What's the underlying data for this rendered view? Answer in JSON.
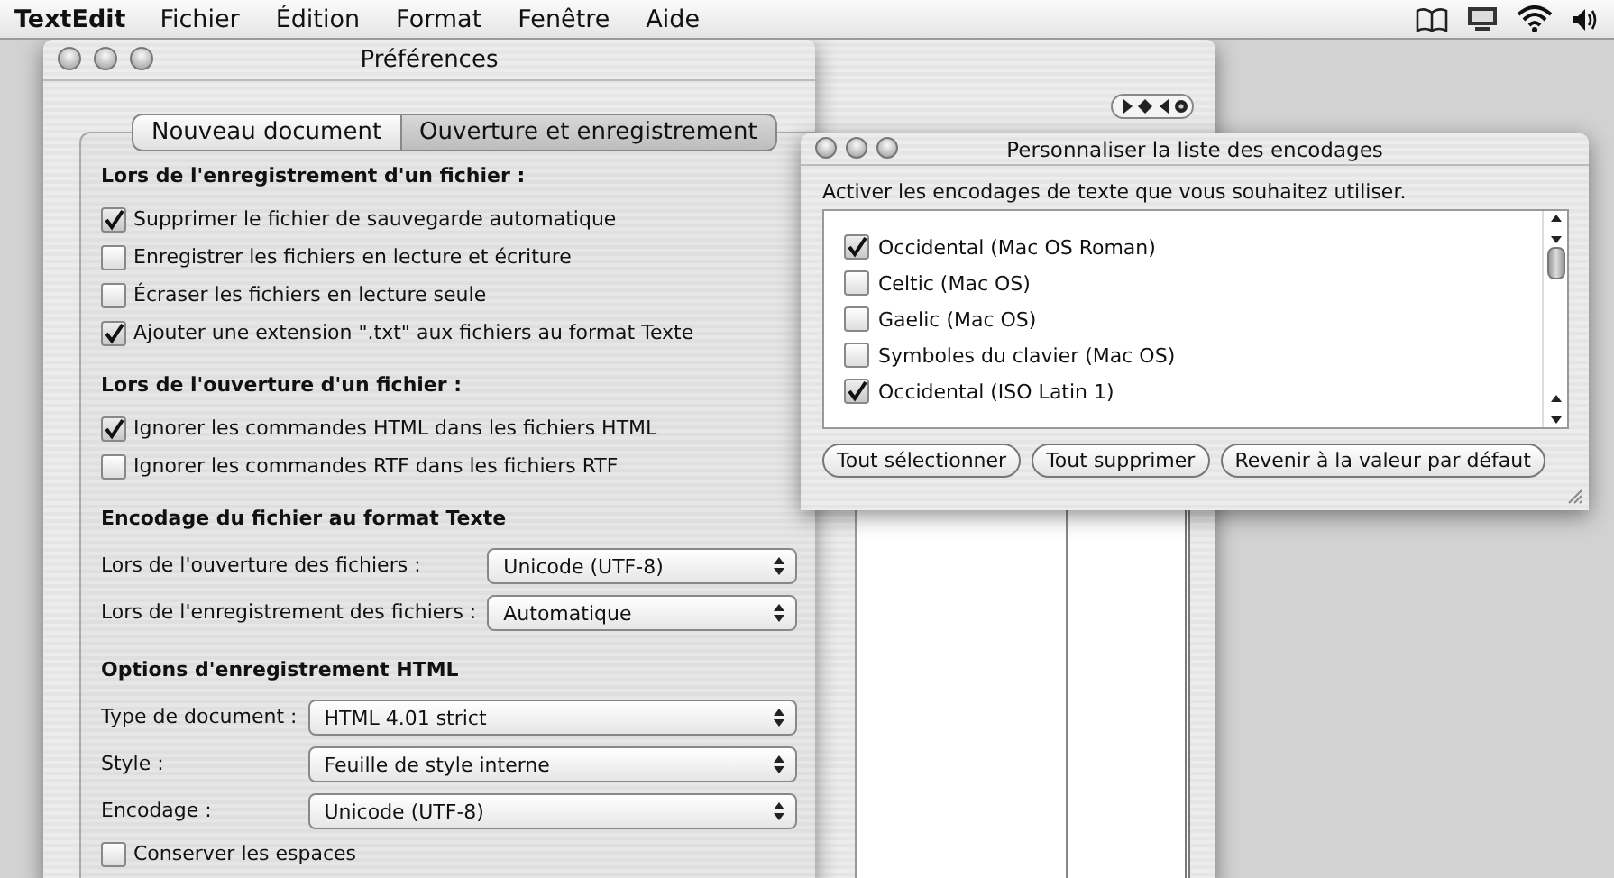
{
  "menubar": {
    "app": "TextEdit",
    "menus": [
      "Fichier",
      "Édition",
      "Format",
      "Fenêtre",
      "Aide"
    ]
  },
  "preferences": {
    "title": "Préférences",
    "tabs": [
      {
        "label": "Nouveau document",
        "selected": false
      },
      {
        "label": "Ouverture et enregistrement",
        "selected": true
      }
    ],
    "sections": [
      {
        "heading": "Lors de l'enregistrement d'un fichier :",
        "items": [
          {
            "kind": "checkbox",
            "label": "Supprimer le fichier de sauvegarde automatique",
            "checked": true
          },
          {
            "kind": "checkbox",
            "label": "Enregistrer les fichiers en lecture et écriture",
            "checked": false
          },
          {
            "kind": "checkbox",
            "label": "Écraser les fichiers en lecture seule",
            "checked": false
          },
          {
            "kind": "checkbox",
            "label": "Ajouter une extension \".txt\" aux fichiers au format Texte",
            "checked": true
          }
        ]
      },
      {
        "heading": "Lors de l'ouverture d'un fichier :",
        "items": [
          {
            "kind": "checkbox",
            "label": "Ignorer les commandes HTML dans les fichiers HTML",
            "checked": true
          },
          {
            "kind": "checkbox",
            "label": "Ignorer les commandes RTF dans les fichiers RTF",
            "checked": false
          }
        ]
      },
      {
        "heading": "Encodage du fichier au format Texte",
        "items": [
          {
            "kind": "popup",
            "label": "Lors de l'ouverture des fichiers :",
            "value": "Unicode (UTF-8)"
          },
          {
            "kind": "popup",
            "label": "Lors de l'enregistrement des fichiers :",
            "value": "Automatique"
          }
        ]
      },
      {
        "heading": "Options d'enregistrement HTML",
        "items": [
          {
            "kind": "popup",
            "label": "Type de document :",
            "value": "HTML 4.01 strict"
          },
          {
            "kind": "popup",
            "label": "Style :",
            "value": "Feuille de style interne"
          },
          {
            "kind": "popup",
            "label": "Encodage :",
            "value": "Unicode (UTF-8)"
          },
          {
            "kind": "checkbox",
            "label": "Conserver les espaces",
            "checked": false
          }
        ]
      }
    ]
  },
  "encodings_dialog": {
    "title": "Personnaliser la liste des encodages",
    "instruction": "Activer les encodages de texte que vous souhaitez utiliser.",
    "encodings": [
      {
        "label": "Occidental (Mac OS Roman)",
        "checked": true
      },
      {
        "label": "Celtic (Mac OS)",
        "checked": false
      },
      {
        "label": "Gaelic (Mac OS)",
        "checked": false
      },
      {
        "label": "Symboles du clavier (Mac OS)",
        "checked": false
      },
      {
        "label": "Occidental (ISO Latin 1)",
        "checked": true
      }
    ],
    "buttons": [
      "Tout sélectionner",
      "Tout supprimer",
      "Revenir à la valeur par défaut"
    ]
  }
}
